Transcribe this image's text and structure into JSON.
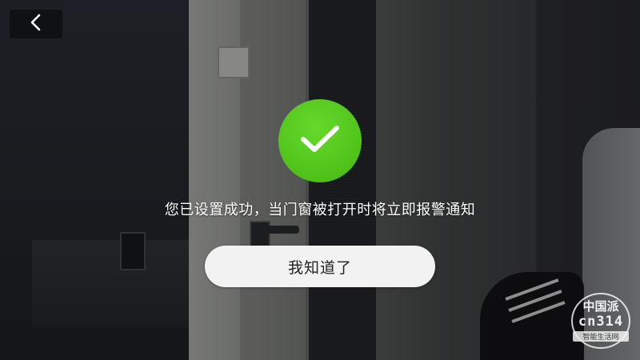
{
  "nav": {
    "back_icon": "chevron-left-icon"
  },
  "status": {
    "icon": "checkmark-icon",
    "icon_color": "#52c51c",
    "message": "您已设置成功，当门窗被打开时将立即报警通知"
  },
  "actions": {
    "confirm_label": "我知道了"
  },
  "watermark": {
    "title": "中国派",
    "code": "cn314",
    "subtitle": "智能生活网"
  }
}
